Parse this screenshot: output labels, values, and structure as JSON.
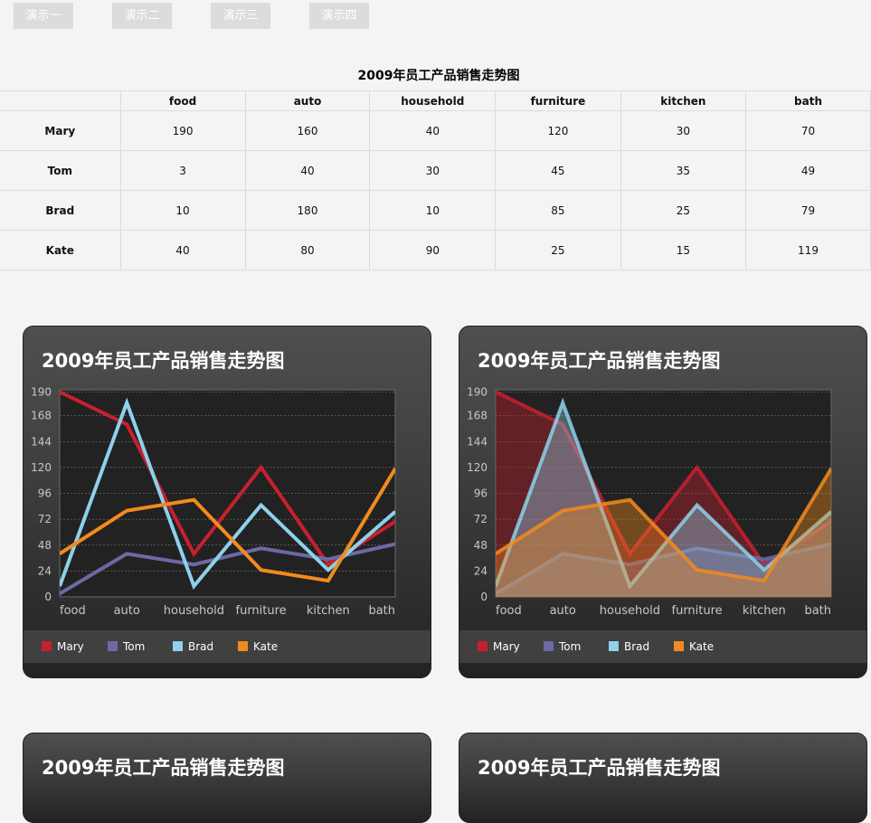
{
  "nav": {
    "buttons": [
      "演示一",
      "演示二",
      "演示三",
      "演示四"
    ]
  },
  "table": {
    "title": "2009年员工产品销售走势图",
    "columns": [
      "food",
      "auto",
      "household",
      "furniture",
      "kitchen",
      "bath"
    ],
    "rows": [
      {
        "name": "Mary",
        "values": [
          "190",
          "160",
          "40",
          "120",
          "30",
          "70"
        ]
      },
      {
        "name": "Tom",
        "values": [
          "3",
          "40",
          "30",
          "45",
          "35",
          "49"
        ]
      },
      {
        "name": "Brad",
        "values": [
          "10",
          "180",
          "10",
          "85",
          "25",
          "79"
        ]
      },
      {
        "name": "Kate",
        "values": [
          "40",
          "80",
          "90",
          "25",
          "15",
          "119"
        ]
      }
    ]
  },
  "colors": {
    "Mary": "#c8202f",
    "Tom": "#6b6aa6",
    "Brad": "#8ed1ea",
    "Kate": "#f28b1e"
  },
  "chart_data": [
    {
      "type": "line",
      "title": "2009年员工产品销售走势图",
      "categories": [
        "food",
        "auto",
        "household",
        "furniture",
        "kitchen",
        "bath"
      ],
      "yticks": [
        0,
        24,
        48,
        72,
        96,
        120,
        144,
        168,
        190
      ],
      "ylim": [
        0,
        192
      ],
      "grid": true,
      "legend": "bottom",
      "series": [
        {
          "name": "Mary",
          "values": [
            190,
            160,
            40,
            120,
            30,
            70
          ]
        },
        {
          "name": "Tom",
          "values": [
            3,
            40,
            30,
            45,
            35,
            49
          ]
        },
        {
          "name": "Brad",
          "values": [
            10,
            180,
            10,
            85,
            25,
            79
          ]
        },
        {
          "name": "Kate",
          "values": [
            40,
            80,
            90,
            25,
            15,
            119
          ]
        }
      ]
    },
    {
      "type": "area",
      "title": "2009年员工产品销售走势图",
      "categories": [
        "food",
        "auto",
        "household",
        "furniture",
        "kitchen",
        "bath"
      ],
      "yticks": [
        0,
        24,
        48,
        72,
        96,
        120,
        144,
        168,
        190
      ],
      "ylim": [
        0,
        192
      ],
      "grid": true,
      "legend": "bottom",
      "series": [
        {
          "name": "Mary",
          "values": [
            190,
            160,
            40,
            120,
            30,
            70
          ]
        },
        {
          "name": "Tom",
          "values": [
            3,
            40,
            30,
            45,
            35,
            49
          ]
        },
        {
          "name": "Brad",
          "values": [
            10,
            180,
            10,
            85,
            25,
            79
          ]
        },
        {
          "name": "Kate",
          "values": [
            40,
            80,
            90,
            25,
            15,
            119
          ]
        }
      ]
    },
    {
      "type": "line",
      "title": "2009年员工产品销售走势图"
    },
    {
      "type": "area",
      "title": "2009年员工产品销售走势图"
    }
  ]
}
